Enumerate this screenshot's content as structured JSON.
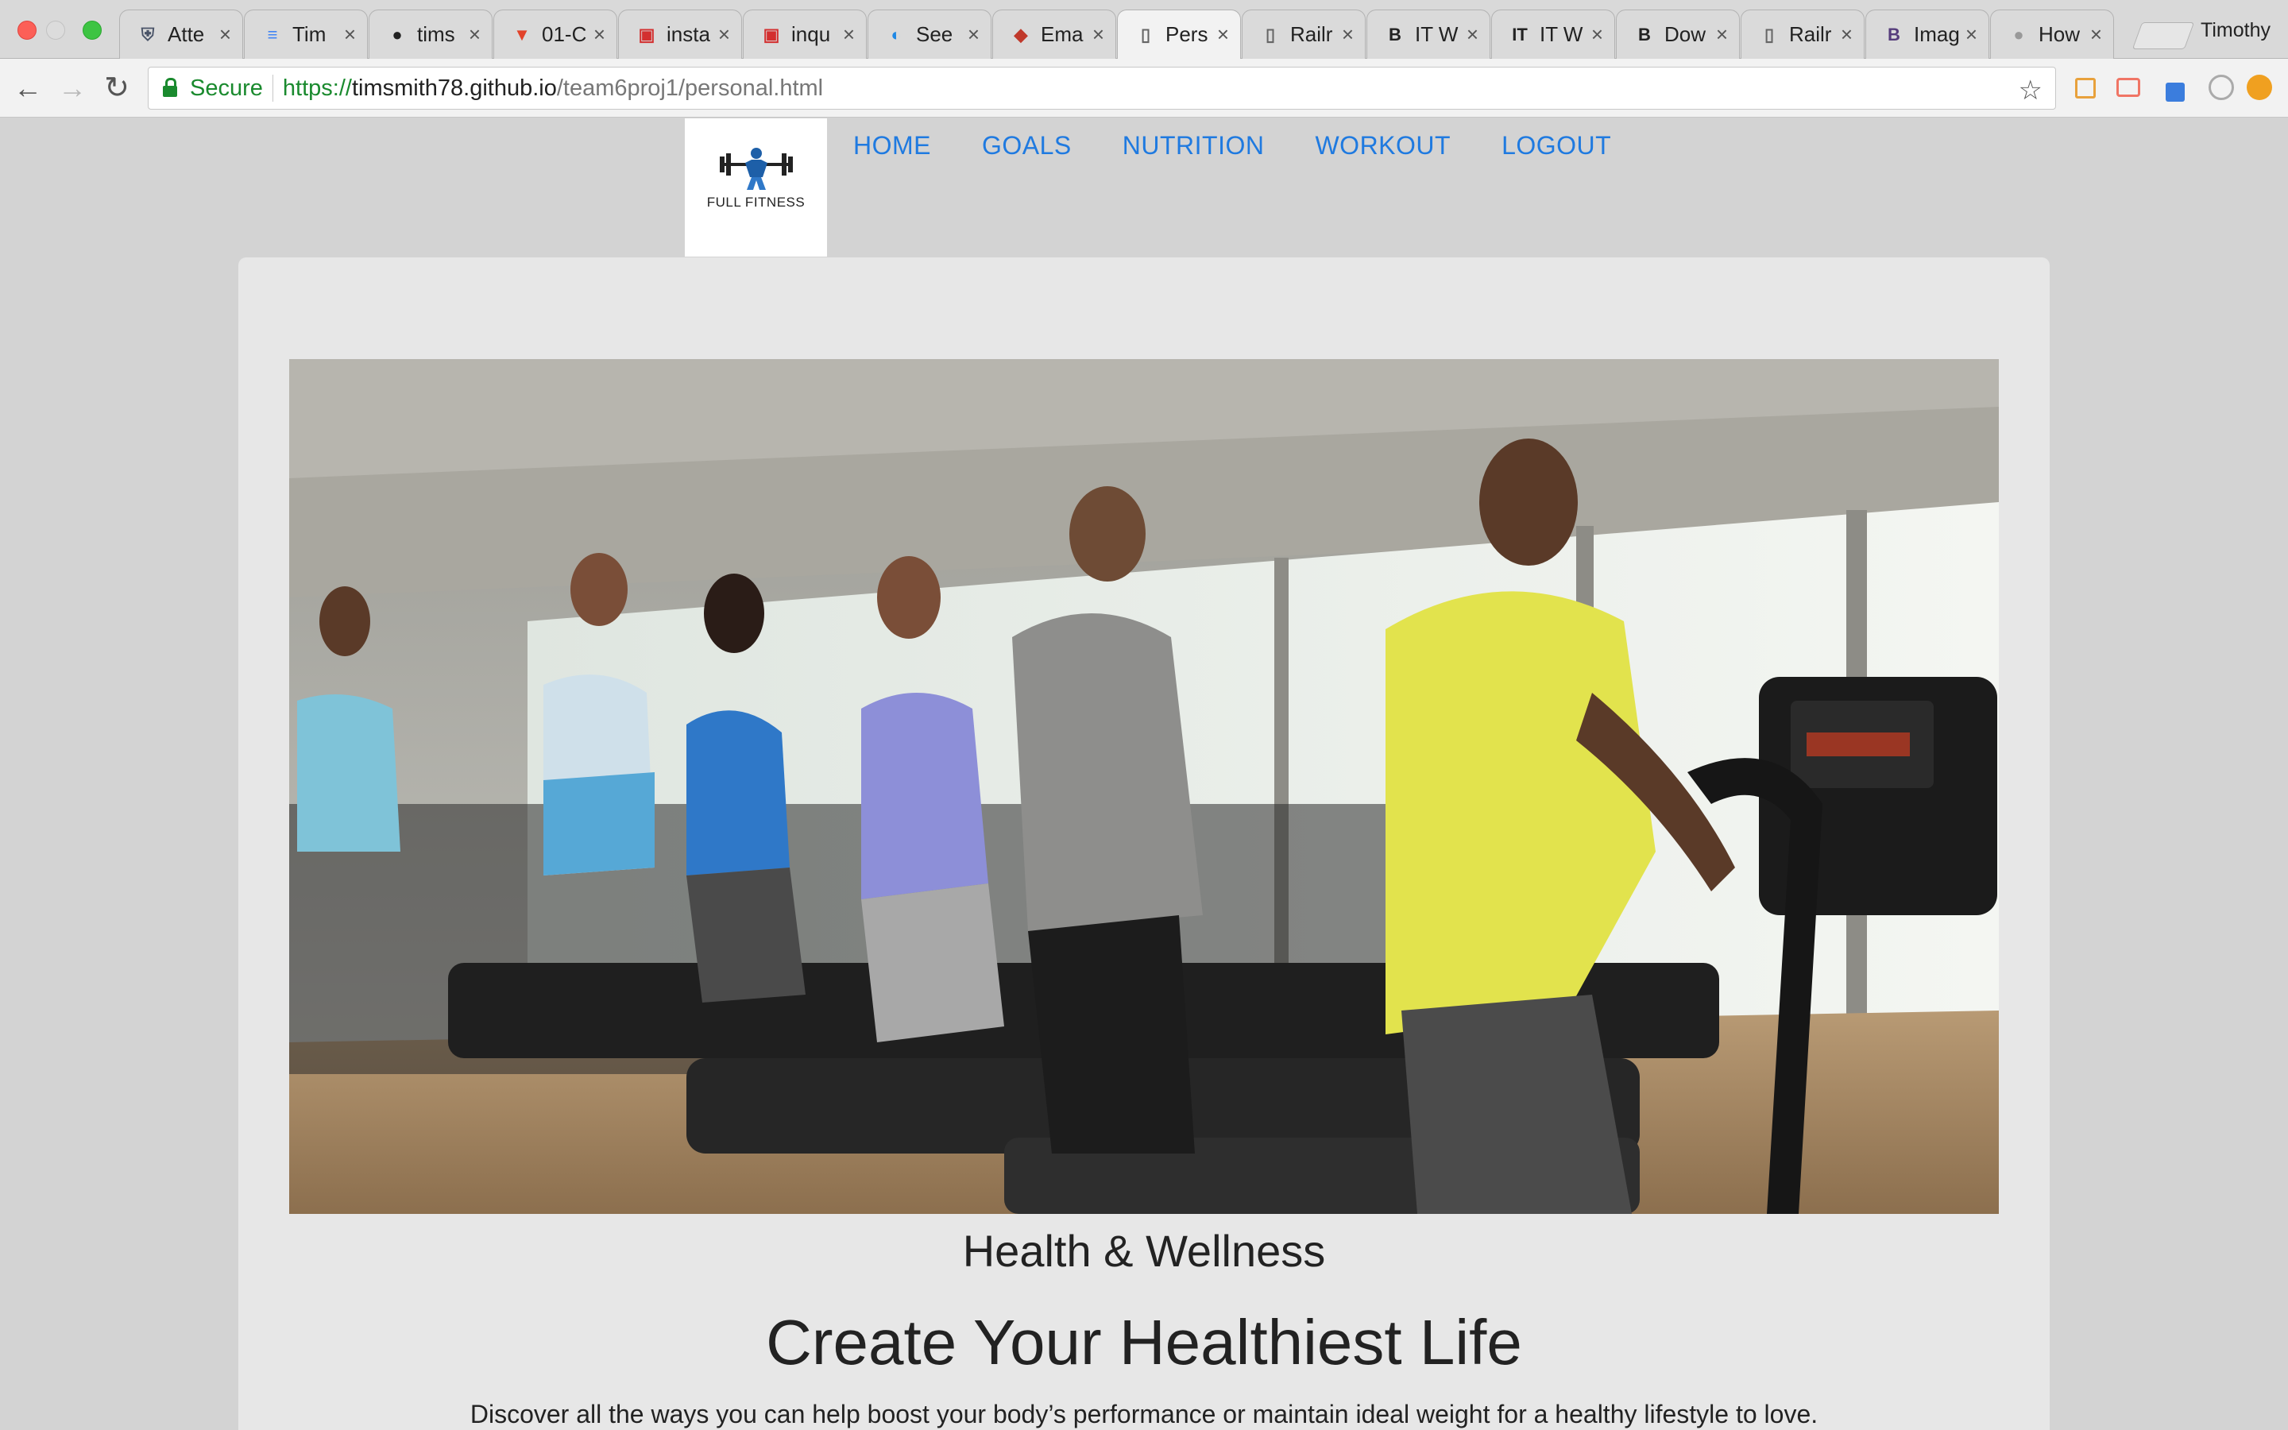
{
  "browser": {
    "tabs": [
      {
        "title": "Atte",
        "icon": "shield-icon",
        "icon_glyph": "⛨",
        "icon_color": "#4a5468"
      },
      {
        "title": "Tim",
        "icon": "docs-icon",
        "icon_glyph": "≡",
        "icon_color": "#4285f4"
      },
      {
        "title": "tims",
        "icon": "github-icon",
        "icon_glyph": "●",
        "icon_color": "#222222"
      },
      {
        "title": "01-C",
        "icon": "gitlab-icon",
        "icon_glyph": "▼",
        "icon_color": "#e2432a"
      },
      {
        "title": "insta",
        "icon": "red-square-icon",
        "icon_glyph": "▣",
        "icon_color": "#d32f2f"
      },
      {
        "title": "inqu",
        "icon": "red-square-icon",
        "icon_glyph": "▣",
        "icon_color": "#d32f2f"
      },
      {
        "title": "See",
        "icon": "swirl-icon",
        "icon_glyph": "◐",
        "icon_color": "#1e88e5"
      },
      {
        "title": "Ema",
        "icon": "layers-icon",
        "icon_glyph": "◆",
        "icon_color": "#c0392b"
      },
      {
        "title": "Pers",
        "icon": "page-icon",
        "icon_glyph": "▯",
        "icon_color": "#666666",
        "active": true
      },
      {
        "title": "Railr",
        "icon": "page-icon",
        "icon_glyph": "▯",
        "icon_color": "#666666"
      },
      {
        "title": "IT W",
        "icon": "bold-b-icon",
        "icon_glyph": "B",
        "icon_color": "#222222"
      },
      {
        "title": "IT W",
        "icon": "it-icon",
        "icon_glyph": "IT",
        "icon_color": "#222222"
      },
      {
        "title": "Dow",
        "icon": "bold-b-icon",
        "icon_glyph": "B",
        "icon_color": "#222222"
      },
      {
        "title": "Railr",
        "icon": "page-icon",
        "icon_glyph": "▯",
        "icon_color": "#666666"
      },
      {
        "title": "Imag",
        "icon": "bootstrap-icon",
        "icon_glyph": "B",
        "icon_color": "#563d7c"
      },
      {
        "title": "How",
        "icon": "apple-icon",
        "icon_glyph": "●",
        "icon_color": "#999999"
      }
    ],
    "close_glyph": "×",
    "profile_name": "Timothy",
    "secure_label": "Secure",
    "url_scheme": "https://",
    "url_host": "timsmith78.github.io",
    "url_path": "/team6proj1/personal.html",
    "back_glyph": "←",
    "forward_glyph": "→",
    "reload_glyph": "↻",
    "star_glyph": "☆"
  },
  "site": {
    "logo_text": "FULL FITNESS",
    "nav": [
      "HOME",
      "GOALS",
      "NUTRITION",
      "WORKOUT",
      "LOGOUT"
    ],
    "caption": "Health & Wellness",
    "headline": "Create Your Healthiest Life",
    "intro": "Discover all the ways you can help boost your body’s performance or maintain ideal weight for a healthy lifestyle to love."
  },
  "colors": {
    "link": "#1f7ae0",
    "page_bg": "#d3d3d3",
    "card_bg": "#e7e7e7",
    "secure_green": "#1a8a2e"
  }
}
